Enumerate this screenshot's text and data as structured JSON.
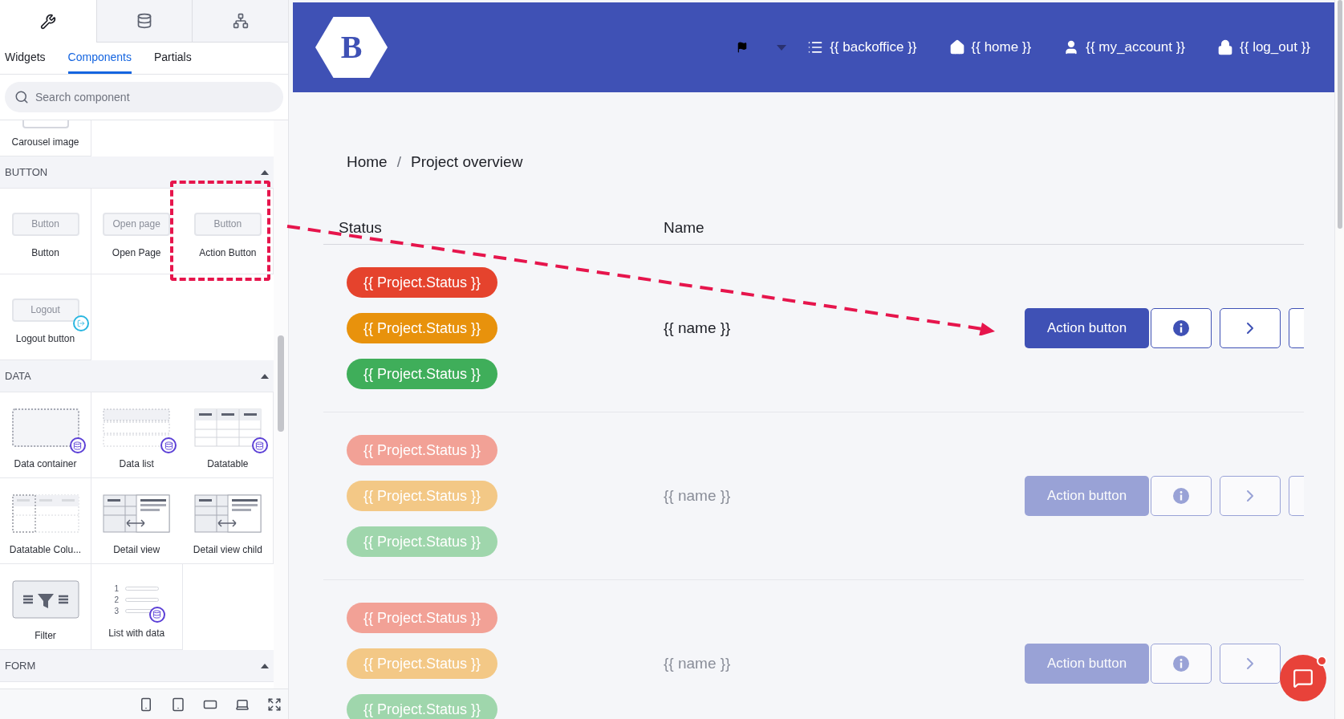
{
  "sidebar": {
    "icon_tabs": [
      {
        "selected": true
      },
      {
        "selected": false
      },
      {
        "selected": false
      }
    ],
    "tabs": [
      {
        "label": "Widgets",
        "selected": false
      },
      {
        "label": "Components",
        "selected": true
      },
      {
        "label": "Partials",
        "selected": false
      }
    ],
    "search": {
      "placeholder": "Search component"
    },
    "sections": [
      {
        "items": [
          {
            "kind": "carousel",
            "label": "Carousel image"
          }
        ]
      },
      {
        "title": "BUTTON",
        "expanded": true,
        "items": [
          {
            "kind": "button",
            "label": "Button",
            "preview": "Button"
          },
          {
            "kind": "button",
            "label": "Open Page",
            "preview": "Open page"
          },
          {
            "kind": "button",
            "label": "Action Button",
            "preview": "Button",
            "highlighted": true
          },
          {
            "kind": "logout",
            "label": "Logout button",
            "preview": "Logout"
          }
        ]
      },
      {
        "title": "DATA",
        "expanded": true,
        "items": [
          {
            "kind": "data_container",
            "label": "Data container"
          },
          {
            "kind": "data_list",
            "label": "Data list"
          },
          {
            "kind": "datatable",
            "label": "Datatable"
          },
          {
            "kind": "datatable_column",
            "label": "Datatable Colu..."
          },
          {
            "kind": "detail_view",
            "label": "Detail view"
          },
          {
            "kind": "detail_view",
            "label": "Detail view child"
          },
          {
            "kind": "filter",
            "label": "Filter"
          },
          {
            "kind": "numbered_list",
            "label": "List with data",
            "numbers": [
              "1",
              "2",
              "3"
            ]
          }
        ]
      },
      {
        "title": "FORM",
        "expanded": true
      }
    ]
  },
  "header": {
    "logo": "B",
    "nav": [
      "{{ backoffice }}",
      "{{ home }}",
      "{{ my_account }}",
      "{{ log_out }}"
    ]
  },
  "breadcrumb": {
    "items": [
      "Home",
      "Project overview"
    ],
    "separator": "/"
  },
  "table": {
    "columns": [
      "Status",
      "Name"
    ],
    "rows": [
      {
        "dimmed": false,
        "statuses": [
          {
            "label": "{{ Project.Status }}",
            "color": "#e5432d"
          },
          {
            "label": "{{ Project.Status }}",
            "color": "#e8920c"
          },
          {
            "label": "{{ Project.Status }}",
            "color": "#3fae5a"
          }
        ],
        "name": "{{ name }}",
        "action": "Action button"
      },
      {
        "dimmed": true,
        "statuses": [
          {
            "label": "{{ Project.Status }}",
            "color": "#f2a196"
          },
          {
            "label": "{{ Project.Status }}",
            "color": "#f3c886"
          },
          {
            "label": "{{ Project.Status }}",
            "color": "#9fd6ac"
          }
        ],
        "name": "{{ name }}",
        "action": "Action button"
      },
      {
        "dimmed": true,
        "statuses": [
          {
            "label": "{{ Project.Status }}",
            "color": "#f2a196"
          },
          {
            "label": "{{ Project.Status }}",
            "color": "#f3c886"
          },
          {
            "label": "{{ Project.Status }}",
            "color": "#9fd6ac"
          }
        ],
        "name": "{{ name }}",
        "action": "Action button",
        "overflow_hidden": true
      }
    ]
  },
  "chat": {
    "unread": true
  }
}
